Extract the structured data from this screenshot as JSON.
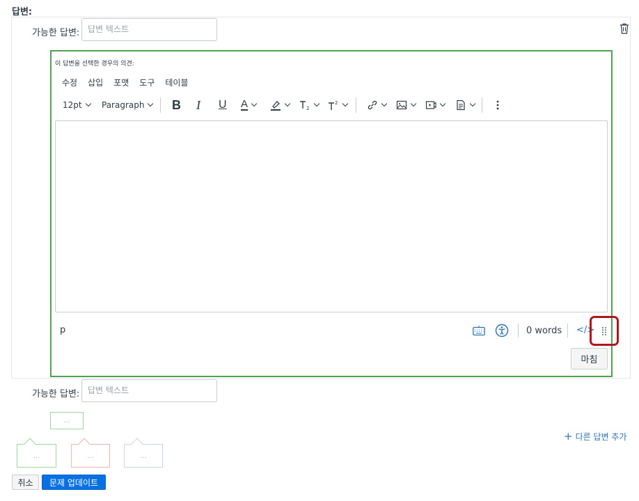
{
  "section_title": "답변:",
  "answers": [
    {
      "label": "가능한 답변:",
      "placeholder": "답변 텍스트"
    },
    {
      "label": "가능한 답변:",
      "placeholder": "답변 텍스트"
    }
  ],
  "comment": {
    "prompt": "이 답변을 선택한 경우의 의견:",
    "menu": [
      "수정",
      "삽입",
      "포맷",
      "도구",
      "테이블"
    ],
    "toolbar": {
      "font_size": "12pt",
      "block_format": "Paragraph",
      "bold": "B",
      "italic": "I",
      "underline": "U",
      "text_color": "A"
    },
    "status": {
      "element_path": "p",
      "word_count": "0 words",
      "html_toggle": "</>"
    },
    "done_label": "마침"
  },
  "comment_pills": [
    "...",
    "...",
    "...",
    "..."
  ],
  "add_answer_label": "다른 답변 추가",
  "add_icon": "+",
  "footer": {
    "cancel_label": "취소",
    "update_label": "문제 업데이트"
  },
  "colors": {
    "accent": "#0770e3",
    "correct_green": "#50a14f",
    "highlight_red": "#b0151d",
    "link_blue": "#2d73b8"
  },
  "icons": [
    "trash-icon",
    "bold-icon",
    "italic-icon",
    "underline-icon",
    "text-color-icon",
    "highlight-icon",
    "subscript-icon",
    "superscript-icon",
    "link-icon",
    "image-icon",
    "media-icon",
    "document-icon",
    "more-icon",
    "keyboard-icon",
    "accessibility-icon",
    "resize-handle-icon",
    "plus-icon"
  ]
}
